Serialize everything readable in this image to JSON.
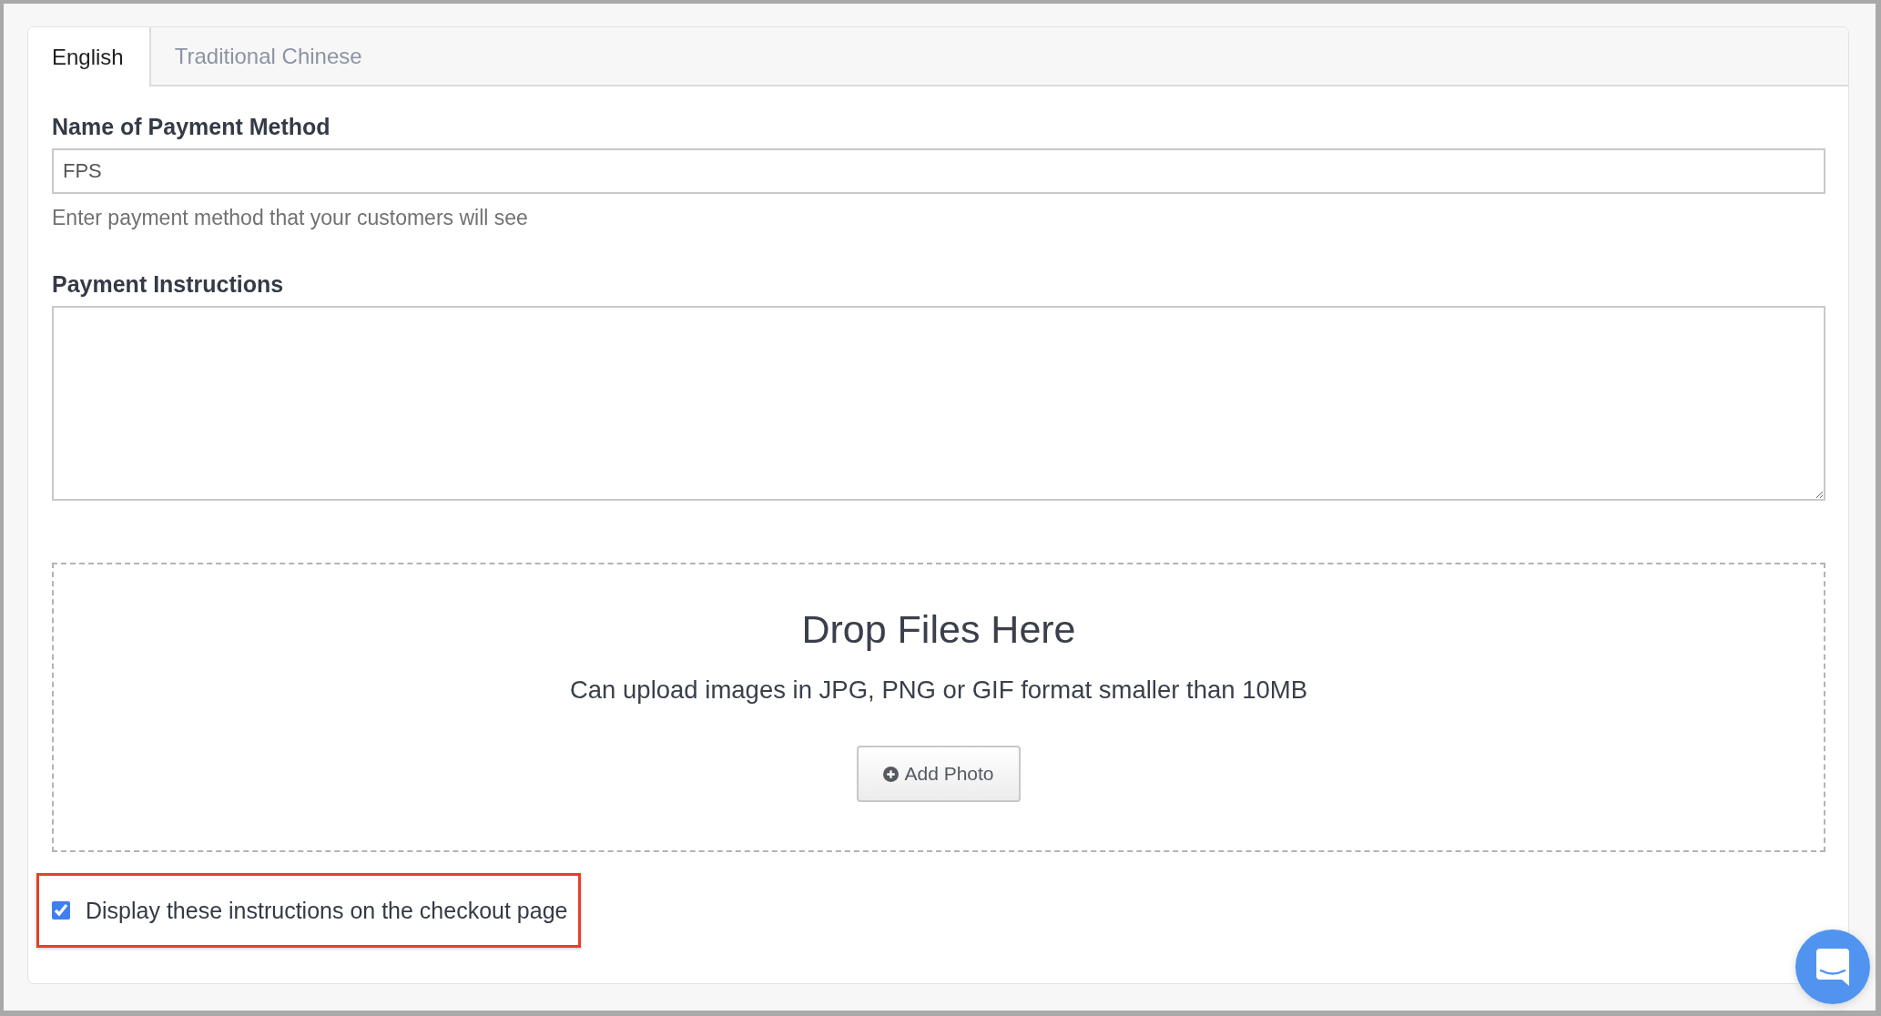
{
  "tabs": [
    {
      "label": "English",
      "selected": true
    },
    {
      "label": "Traditional Chinese",
      "selected": false
    }
  ],
  "name_field": {
    "label": "Name of Payment Method",
    "value": "FPS",
    "help": "Enter payment method that your customers will see"
  },
  "instructions_field": {
    "label": "Payment Instructions"
  },
  "upload": {
    "title": "Drop Files Here",
    "subtitle": "Can upload images in JPG, PNG or GIF format smaller than 10MB",
    "button": "Add Photo"
  },
  "display_option": {
    "label": "Display these instructions on the checkout page",
    "checked": true,
    "highlighted": true
  }
}
